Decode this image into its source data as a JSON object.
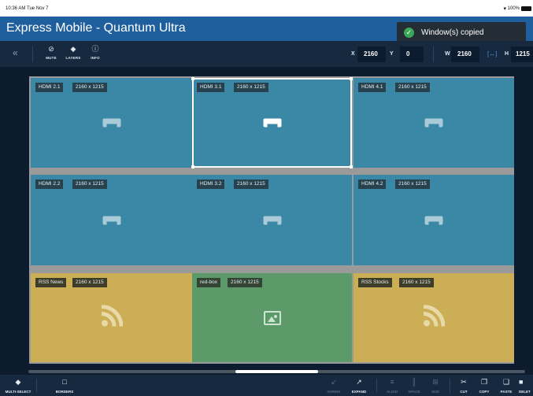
{
  "statusbar": {
    "time": "10:36 AM",
    "date": "Tue Nov 7",
    "battery": "100%"
  },
  "title": "Express Mobile - Quantum Ultra",
  "toast": {
    "message": "Window(s) copied"
  },
  "toolbar": {
    "collapse": "«",
    "tools": [
      {
        "label": "MUTE",
        "icon": "mute-icon"
      },
      {
        "label": "LAYERS",
        "icon": "layers-icon"
      },
      {
        "label": "INFO",
        "icon": "info-icon"
      }
    ],
    "x_label": "X",
    "x_value": "2160",
    "y_label": "Y",
    "y_value": "0",
    "w_label": "W",
    "w_value": "2160",
    "h_label": "H",
    "h_value": "1215"
  },
  "tiles": [
    {
      "name": "HDMI 2.1",
      "size": "2160 x 1215",
      "type": "hdmi"
    },
    {
      "name": "HDMI 3.1",
      "size": "2160 x 1215",
      "type": "hdmi",
      "selected": true
    },
    {
      "name": "HDMI 4.1",
      "size": "2160 x 1215",
      "type": "hdmi"
    },
    {
      "name": "HDMI 2.2",
      "size": "2160 x 1215",
      "type": "hdmi"
    },
    {
      "name": "HDMI 3.2",
      "size": "2160 x 1215",
      "type": "hdmi"
    },
    {
      "name": "HDMI 4.2",
      "size": "2160 x 1215",
      "type": "hdmi"
    },
    {
      "name": "RSS News",
      "size": "2160 x 1215",
      "type": "rss"
    },
    {
      "name": "red-box",
      "size": "2160 x 1215",
      "type": "image"
    },
    {
      "name": "RSS Stocks",
      "size": "2160 x 1215",
      "type": "rss"
    }
  ],
  "bottombar": {
    "multiselect": "MULTI-SELECT",
    "borders": "BORDERS",
    "shrink": "SHRINK",
    "expand": "EXPAND",
    "align": "ALIGN",
    "space": "SPACE",
    "size": "SIZE",
    "cut": "CUT",
    "copy": "COPY",
    "paste": "PASTE",
    "delete": "DELET"
  },
  "colors": {
    "hdmi": "#3a87a6",
    "rss": "#ccae57",
    "image": "#5c9a6a",
    "titlebar": "#1f5f9d",
    "toast_success": "#3aa856"
  }
}
